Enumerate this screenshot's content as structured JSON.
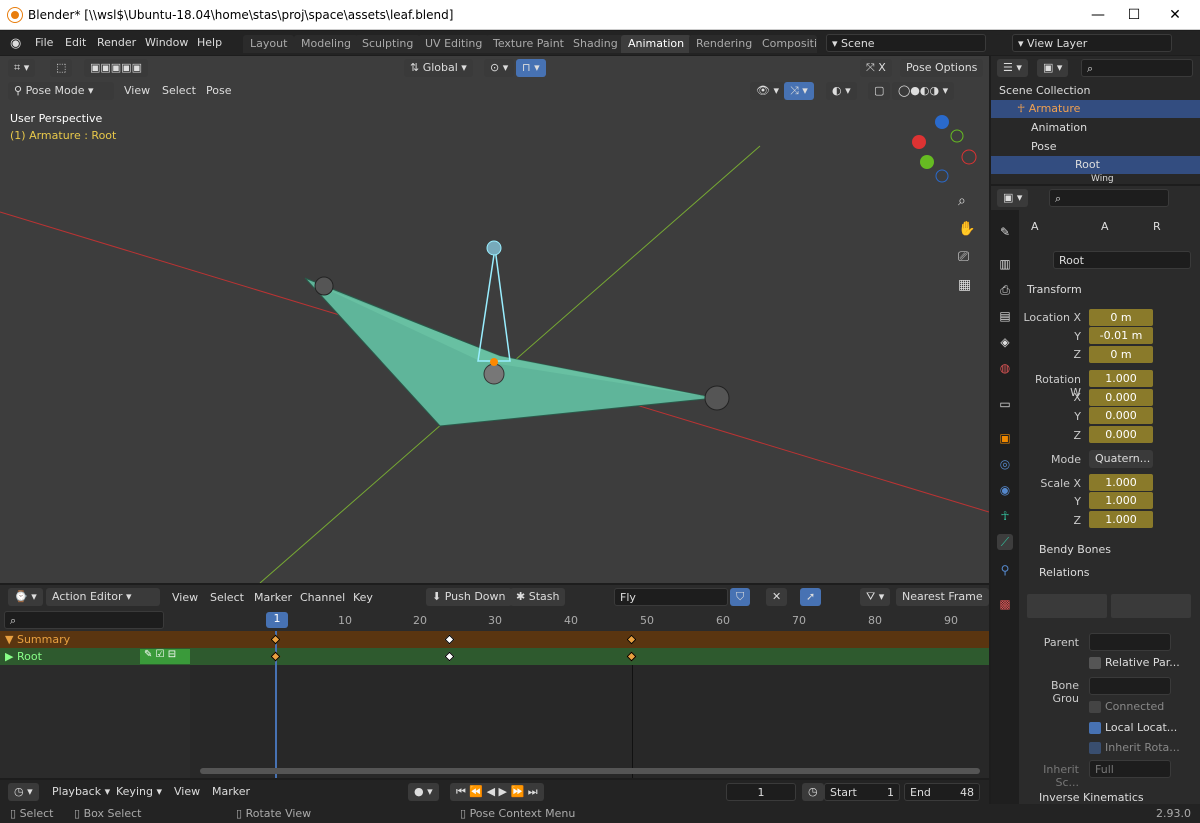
{
  "window": {
    "title": "Blender* [\\\\wsl$\\Ubuntu-18.04\\home\\stas\\proj\\space\\assets\\leaf.blend]",
    "minimize": "—",
    "maximize": "☐",
    "close": "✕"
  },
  "menu": [
    "File",
    "Edit",
    "Render",
    "Window",
    "Help"
  ],
  "workspaces": [
    "Layout",
    "Modeling",
    "Sculpting",
    "UV Editing",
    "Texture Paint",
    "Shading",
    "Animation",
    "Rendering",
    "Compositing"
  ],
  "scene": "Scene",
  "view_layer": "View Layer",
  "viewport": {
    "transform_orient": "Global",
    "pose_options": "Pose Options",
    "mode": "Pose Mode",
    "menus": [
      "View",
      "Select",
      "Pose"
    ],
    "perspective": "User Perspective",
    "active": "(1) Armature : Root"
  },
  "outliner": {
    "root": "Scene Collection",
    "items": [
      "Armature",
      "Animation",
      "Pose",
      "Root",
      "Wing L"
    ]
  },
  "props": {
    "bone_name": "Root",
    "tab_short": [
      "A",
      "A",
      "R"
    ],
    "transform": "Transform",
    "loc_label": "Location X",
    "loc": [
      "0 m",
      "-0.01 m",
      "0 m"
    ],
    "rot_label": "Rotation W",
    "rot": [
      "1.000",
      "0.000",
      "0.000",
      "0.000"
    ],
    "axis": [
      "X",
      "Y",
      "Z"
    ],
    "mode_label": "Mode",
    "mode": "Quatern...",
    "scale_label": "Scale X",
    "scale": [
      "1.000",
      "1.000",
      "1.000"
    ],
    "bendy": "Bendy Bones",
    "relations": "Relations",
    "parent": "Parent",
    "relative_parent": "Relative Par...",
    "bone_group": "Bone Grou",
    "connected": "Connected",
    "local_location": "Local Locat...",
    "inherit_rotation": "Inherit Rota...",
    "inherit_scale": "Inherit Sc...",
    "inherit_scale_val": "Full",
    "ik": "Inverse Kinematics"
  },
  "action": {
    "editor": "Action Editor",
    "menus": [
      "View",
      "Select",
      "Marker",
      "Channel",
      "Key"
    ],
    "push_down": "Push Down",
    "stash": "Stash",
    "action_name": "Fly",
    "snap": "Nearest Frame",
    "frames": [
      "1",
      "10",
      "20",
      "30",
      "40",
      "50",
      "60",
      "70",
      "80",
      "90"
    ],
    "current": "1",
    "channels": [
      "Summary",
      "Root"
    ]
  },
  "timeline": {
    "menus": [
      "Playback",
      "Keying",
      "View",
      "Marker"
    ],
    "frame": "1",
    "start_label": "Start",
    "start": "1",
    "end_label": "End",
    "end": "48"
  },
  "status": {
    "items": [
      "Select",
      "Box Select",
      "Rotate View",
      "Pose Context Menu"
    ],
    "version": "2.93.0"
  }
}
